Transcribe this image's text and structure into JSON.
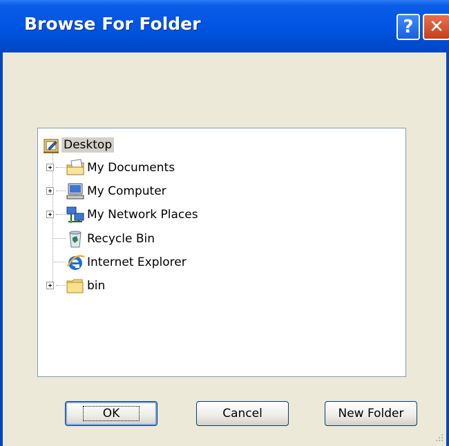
{
  "window": {
    "title": "Browse For Folder",
    "help_glyph": "?",
    "close_glyph": "✕"
  },
  "tree": {
    "items": [
      {
        "label": "Desktop",
        "icon": "desktop-icon"
      },
      {
        "label": "My Documents",
        "icon": "my-documents-icon"
      },
      {
        "label": "My Computer",
        "icon": "my-computer-icon"
      },
      {
        "label": "My Network Places",
        "icon": "my-network-places-icon"
      },
      {
        "label": "Recycle Bin",
        "icon": "recycle-bin-icon"
      },
      {
        "label": "Internet Explorer",
        "icon": "internet-explorer-icon"
      },
      {
        "label": "bin",
        "icon": "folder-icon"
      }
    ]
  },
  "buttons": {
    "ok": "OK",
    "cancel": "Cancel",
    "new_folder": "New Folder"
  },
  "colors": {
    "title_bar": "#0054e3",
    "dialog_bg": "#ece9d8",
    "selection": "#d4d0c8"
  }
}
